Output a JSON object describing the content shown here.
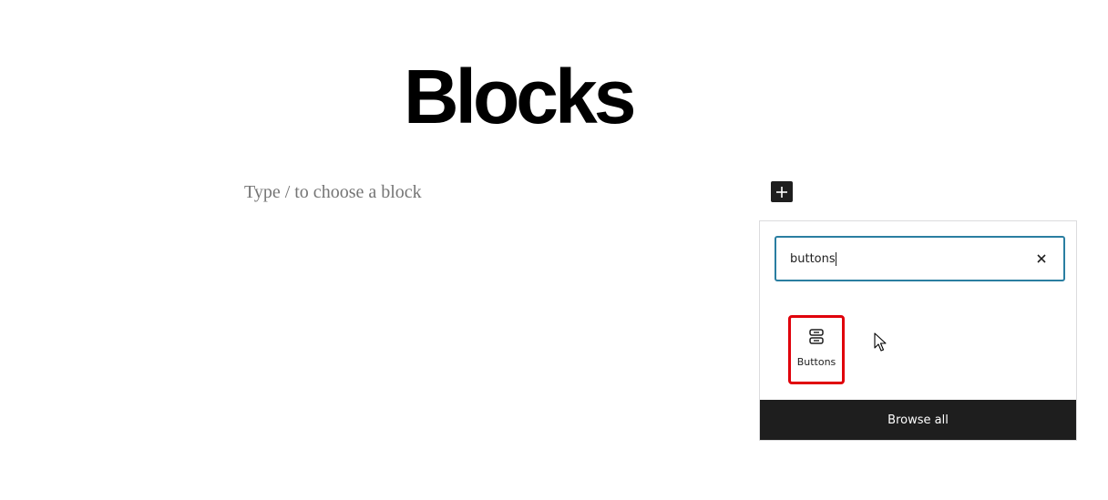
{
  "page": {
    "title": "Blocks",
    "placeholder": "Type / to choose a block"
  },
  "inserter": {
    "toggle_icon": "plus-icon",
    "search": {
      "value": "buttons",
      "clear_icon": "close-icon"
    },
    "results": [
      {
        "label": "Buttons",
        "icon": "buttons-block-icon",
        "highlight_color": "#e0000b"
      }
    ],
    "browse_all_label": "Browse all"
  },
  "colors": {
    "dark": "#1e1e1e",
    "accent_border": "#2a7ea1",
    "highlight": "#e0000b",
    "placeholder_text": "#757575"
  }
}
